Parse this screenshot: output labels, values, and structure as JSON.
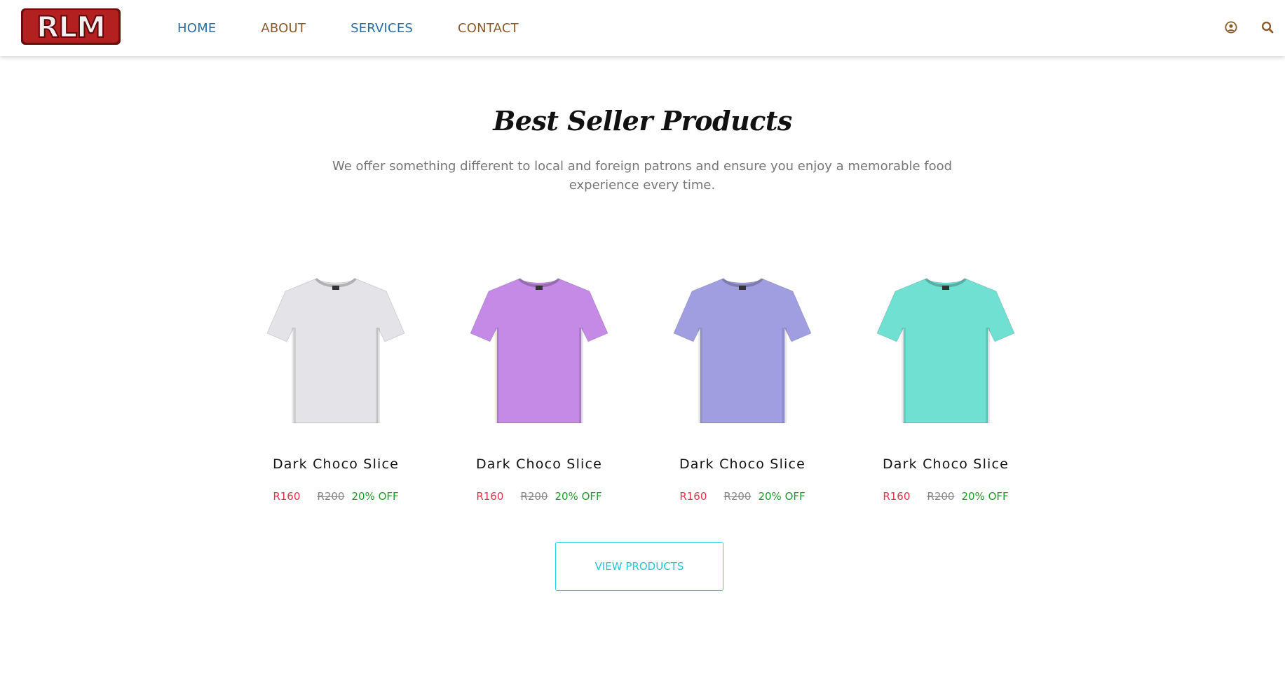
{
  "brand": {
    "logo_text": "RLM",
    "logo_fill": "#f4eeee",
    "logo_outline": "#8b1a1a"
  },
  "nav": {
    "links": [
      {
        "label": "HOME",
        "color": "#2a6da0"
      },
      {
        "label": "ABOUT",
        "color": "#8a5a2b"
      },
      {
        "label": "SERVICES",
        "color": "#2a6da0"
      },
      {
        "label": "CONTACT",
        "color": "#8a5a2b"
      }
    ],
    "icons": [
      "user-circle-icon",
      "search-icon"
    ],
    "icon_color": "#8a5a2b"
  },
  "section": {
    "title": "Best Seller Products",
    "subtitle": "We offer something different to local and foreign patrons and ensure you enjoy a memorable food experience every time."
  },
  "products": [
    {
      "name": "Dark Choco Slice",
      "price": "R160",
      "old_price": "R200",
      "discount": "20% OFF",
      "shirt_color": "#e4e4e8"
    },
    {
      "name": "Dark Choco Slice",
      "price": "R160",
      "old_price": "R200",
      "discount": "20% OFF",
      "shirt_color": "#c48ae6"
    },
    {
      "name": "Dark Choco Slice",
      "price": "R160",
      "old_price": "R200",
      "discount": "20% OFF",
      "shirt_color": "#a09ee0"
    },
    {
      "name": "Dark Choco Slice",
      "price": "R160",
      "old_price": "R200",
      "discount": "20% OFF",
      "shirt_color": "#6fe0d2"
    }
  ],
  "cta": {
    "label": "VIEW PRODUCTS"
  }
}
